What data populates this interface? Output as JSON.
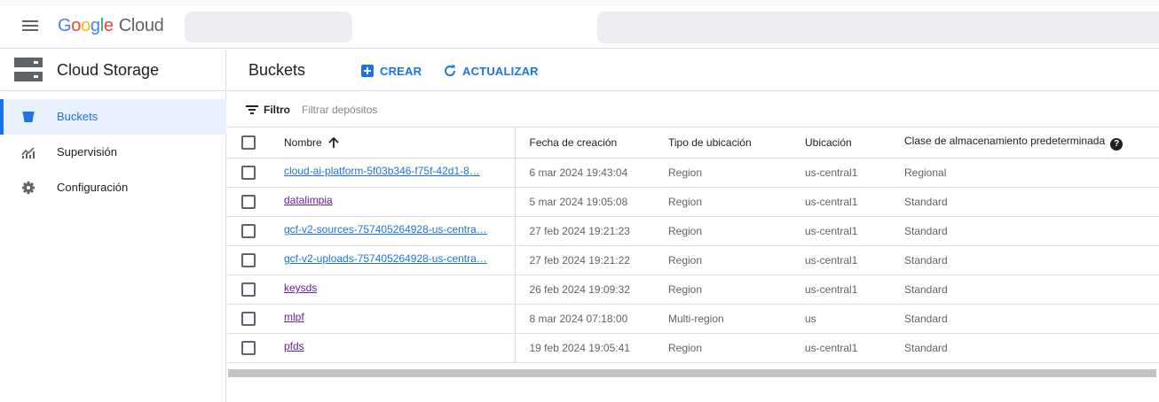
{
  "header": {
    "logo_parts": [
      "G",
      "o",
      "o",
      "g",
      "l",
      "e"
    ],
    "logo_cloud": "Cloud"
  },
  "sidebar": {
    "product_title": "Cloud Storage",
    "items": [
      {
        "label": "Buckets",
        "icon": "bucket-icon",
        "active": true
      },
      {
        "label": "Supervisión",
        "icon": "monitoring-icon",
        "active": false
      },
      {
        "label": "Configuración",
        "icon": "gear-icon",
        "active": false
      }
    ]
  },
  "main": {
    "title": "Buckets",
    "create_label": "CREAR",
    "refresh_label": "ACTUALIZAR",
    "filter_label": "Filtro",
    "filter_placeholder": "Filtrar depósitos"
  },
  "table": {
    "columns": {
      "name": "Nombre",
      "date": "Fecha de creación",
      "location_type": "Tipo de ubicación",
      "location": "Ubicación",
      "storage_class": "Clase de almacenamiento predeterminada"
    },
    "rows": [
      {
        "name": "cloud-ai-platform-5f03b346-f75f-42d1-8…",
        "date": "6 mar 2024 19:43:04",
        "location_type": "Region",
        "location": "us-central1",
        "storage_class": "Regional",
        "visited": false
      },
      {
        "name": "datalimpia",
        "date": "5 mar 2024 19:05:08",
        "location_type": "Region",
        "location": "us-central1",
        "storage_class": "Standard",
        "visited": true
      },
      {
        "name": "gcf-v2-sources-757405264928-us-centra…",
        "date": "27 feb 2024 19:21:23",
        "location_type": "Region",
        "location": "us-central1",
        "storage_class": "Standard",
        "visited": false
      },
      {
        "name": "gcf-v2-uploads-757405264928-us-centra…",
        "date": "27 feb 2024 19:21:22",
        "location_type": "Region",
        "location": "us-central1",
        "storage_class": "Standard",
        "visited": false
      },
      {
        "name": "keysds",
        "date": "26 feb 2024 19:09:32",
        "location_type": "Region",
        "location": "us-central1",
        "storage_class": "Standard",
        "visited": true
      },
      {
        "name": "mlpf",
        "date": "8 mar 2024 07:18:00",
        "location_type": "Multi-region",
        "location": "us",
        "storage_class": "Standard",
        "visited": true
      },
      {
        "name": "pfds",
        "date": "19 feb 2024 19:05:41",
        "location_type": "Region",
        "location": "us-central1",
        "storage_class": "Standard",
        "visited": true
      }
    ]
  },
  "colors": {
    "accent": "#1a73e8",
    "visited_link": "#681da8",
    "active_nav_bg": "#e8f0fe"
  }
}
